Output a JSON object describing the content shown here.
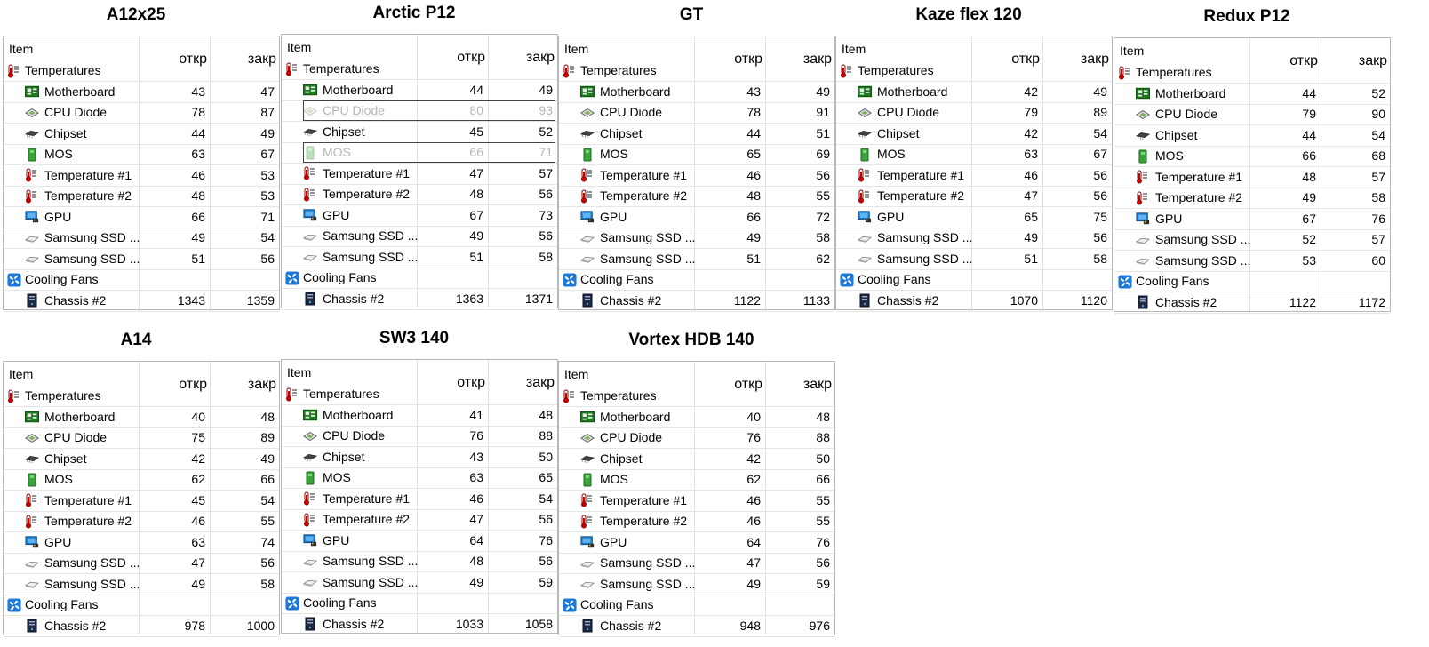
{
  "header": {
    "item": "Item",
    "col1": "откр",
    "col2": "закр"
  },
  "groups": {
    "temps": "Temperatures",
    "fans": "Cooling Fans"
  },
  "colors": {
    "text": "#000000",
    "grid": "#e0e0e0",
    "border": "#b8b8b8",
    "dimmed": "#b6b6b6"
  },
  "panels": [
    {
      "title": "A12x25",
      "rows": [
        {
          "label": "Motherboard",
          "icon": "motherboard-icon",
          "v1": "43",
          "v2": "47"
        },
        {
          "label": "CPU Diode",
          "icon": "cpu-diode-icon",
          "v1": "78",
          "v2": "87"
        },
        {
          "label": "Chipset",
          "icon": "chipset-icon",
          "v1": "44",
          "v2": "49"
        },
        {
          "label": "MOS",
          "icon": "mos-icon",
          "v1": "63",
          "v2": "67"
        },
        {
          "label": "Temperature #1",
          "icon": "thermometer-icon",
          "v1": "46",
          "v2": "53"
        },
        {
          "label": "Temperature #2",
          "icon": "thermometer-icon",
          "v1": "48",
          "v2": "53"
        },
        {
          "label": "GPU",
          "icon": "gpu-icon",
          "v1": "66",
          "v2": "71"
        },
        {
          "label": "Samsung SSD ...",
          "icon": "ssd-icon",
          "v1": "49",
          "v2": "54"
        },
        {
          "label": "Samsung SSD ...",
          "icon": "ssd-icon",
          "v1": "51",
          "v2": "56"
        }
      ],
      "fan": {
        "label": "Chassis #2",
        "icon": "chassis-icon",
        "v1": "1343",
        "v2": "1359"
      }
    },
    {
      "title": "Arctic P12",
      "rows": [
        {
          "label": "Motherboard",
          "icon": "motherboard-icon",
          "v1": "44",
          "v2": "49"
        },
        {
          "label": "CPU Diode",
          "icon": "cpu-diode-icon",
          "v1": "80",
          "v2": "93",
          "dim": true
        },
        {
          "label": "Chipset",
          "icon": "chipset-icon",
          "v1": "45",
          "v2": "52"
        },
        {
          "label": "MOS",
          "icon": "mos-icon",
          "v1": "66",
          "v2": "71",
          "dim": true
        },
        {
          "label": "Temperature #1",
          "icon": "thermometer-icon",
          "v1": "47",
          "v2": "57"
        },
        {
          "label": "Temperature #2",
          "icon": "thermometer-icon",
          "v1": "48",
          "v2": "56"
        },
        {
          "label": "GPU",
          "icon": "gpu-icon",
          "v1": "67",
          "v2": "73"
        },
        {
          "label": "Samsung SSD ...",
          "icon": "ssd-icon",
          "v1": "49",
          "v2": "56"
        },
        {
          "label": "Samsung SSD ...",
          "icon": "ssd-icon",
          "v1": "51",
          "v2": "58"
        }
      ],
      "fan": {
        "label": "Chassis #2",
        "icon": "chassis-icon",
        "v1": "1363",
        "v2": "1371"
      }
    },
    {
      "title": "GT",
      "rows": [
        {
          "label": "Motherboard",
          "icon": "motherboard-icon",
          "v1": "43",
          "v2": "49"
        },
        {
          "label": "CPU Diode",
          "icon": "cpu-diode-icon",
          "v1": "78",
          "v2": "91"
        },
        {
          "label": "Chipset",
          "icon": "chipset-icon",
          "v1": "44",
          "v2": "51"
        },
        {
          "label": "MOS",
          "icon": "mos-icon",
          "v1": "65",
          "v2": "69"
        },
        {
          "label": "Temperature #1",
          "icon": "thermometer-icon",
          "v1": "46",
          "v2": "56"
        },
        {
          "label": "Temperature #2",
          "icon": "thermometer-icon",
          "v1": "48",
          "v2": "55"
        },
        {
          "label": "GPU",
          "icon": "gpu-icon",
          "v1": "66",
          "v2": "72"
        },
        {
          "label": "Samsung SSD ...",
          "icon": "ssd-icon",
          "v1": "49",
          "v2": "58"
        },
        {
          "label": "Samsung SSD ...",
          "icon": "ssd-icon",
          "v1": "51",
          "v2": "62"
        }
      ],
      "fan": {
        "label": "Chassis #2",
        "icon": "chassis-icon",
        "v1": "1122",
        "v2": "1133"
      }
    },
    {
      "title": "Kaze flex 120",
      "rows": [
        {
          "label": "Motherboard",
          "icon": "motherboard-icon",
          "v1": "42",
          "v2": "49"
        },
        {
          "label": "CPU Diode",
          "icon": "cpu-diode-icon",
          "v1": "79",
          "v2": "89"
        },
        {
          "label": "Chipset",
          "icon": "chipset-icon",
          "v1": "42",
          "v2": "54"
        },
        {
          "label": "MOS",
          "icon": "mos-icon",
          "v1": "63",
          "v2": "67"
        },
        {
          "label": "Temperature #1",
          "icon": "thermometer-icon",
          "v1": "46",
          "v2": "56"
        },
        {
          "label": "Temperature #2",
          "icon": "thermometer-icon",
          "v1": "47",
          "v2": "56"
        },
        {
          "label": "GPU",
          "icon": "gpu-icon",
          "v1": "65",
          "v2": "75"
        },
        {
          "label": "Samsung SSD ...",
          "icon": "ssd-icon",
          "v1": "49",
          "v2": "56"
        },
        {
          "label": "Samsung SSD ...",
          "icon": "ssd-icon",
          "v1": "51",
          "v2": "58"
        }
      ],
      "fan": {
        "label": "Chassis #2",
        "icon": "chassis-icon",
        "v1": "1070",
        "v2": "1120"
      }
    },
    {
      "title": "Redux P12",
      "rows": [
        {
          "label": "Motherboard",
          "icon": "motherboard-icon",
          "v1": "44",
          "v2": "52"
        },
        {
          "label": "CPU Diode",
          "icon": "cpu-diode-icon",
          "v1": "79",
          "v2": "90"
        },
        {
          "label": "Chipset",
          "icon": "chipset-icon",
          "v1": "44",
          "v2": "54"
        },
        {
          "label": "MOS",
          "icon": "mos-icon",
          "v1": "66",
          "v2": "68"
        },
        {
          "label": "Temperature #1",
          "icon": "thermometer-icon",
          "v1": "48",
          "v2": "57"
        },
        {
          "label": "Temperature #2",
          "icon": "thermometer-icon",
          "v1": "49",
          "v2": "58"
        },
        {
          "label": "GPU",
          "icon": "gpu-icon",
          "v1": "67",
          "v2": "76"
        },
        {
          "label": "Samsung SSD ...",
          "icon": "ssd-icon",
          "v1": "52",
          "v2": "57"
        },
        {
          "label": "Samsung SSD ...",
          "icon": "ssd-icon",
          "v1": "53",
          "v2": "60"
        }
      ],
      "fan": {
        "label": "Chassis #2",
        "icon": "chassis-icon",
        "v1": "1122",
        "v2": "1172"
      }
    },
    {
      "title": "A14",
      "rows": [
        {
          "label": "Motherboard",
          "icon": "motherboard-icon",
          "v1": "40",
          "v2": "48"
        },
        {
          "label": "CPU Diode",
          "icon": "cpu-diode-icon",
          "v1": "75",
          "v2": "89"
        },
        {
          "label": "Chipset",
          "icon": "chipset-icon",
          "v1": "42",
          "v2": "49"
        },
        {
          "label": "MOS",
          "icon": "mos-icon",
          "v1": "62",
          "v2": "66"
        },
        {
          "label": "Temperature #1",
          "icon": "thermometer-icon",
          "v1": "45",
          "v2": "54"
        },
        {
          "label": "Temperature #2",
          "icon": "thermometer-icon",
          "v1": "46",
          "v2": "55"
        },
        {
          "label": "GPU",
          "icon": "gpu-icon",
          "v1": "63",
          "v2": "74"
        },
        {
          "label": "Samsung SSD ...",
          "icon": "ssd-icon",
          "v1": "47",
          "v2": "56"
        },
        {
          "label": "Samsung SSD ...",
          "icon": "ssd-icon",
          "v1": "49",
          "v2": "58"
        }
      ],
      "fan": {
        "label": "Chassis #2",
        "icon": "chassis-icon",
        "v1": "978",
        "v2": "1000"
      }
    },
    {
      "title": "SW3 140",
      "rows": [
        {
          "label": "Motherboard",
          "icon": "motherboard-icon",
          "v1": "41",
          "v2": "48"
        },
        {
          "label": "CPU Diode",
          "icon": "cpu-diode-icon",
          "v1": "76",
          "v2": "88"
        },
        {
          "label": "Chipset",
          "icon": "chipset-icon",
          "v1": "43",
          "v2": "50"
        },
        {
          "label": "MOS",
          "icon": "mos-icon",
          "v1": "63",
          "v2": "65"
        },
        {
          "label": "Temperature #1",
          "icon": "thermometer-icon",
          "v1": "46",
          "v2": "54"
        },
        {
          "label": "Temperature #2",
          "icon": "thermometer-icon",
          "v1": "47",
          "v2": "56"
        },
        {
          "label": "GPU",
          "icon": "gpu-icon",
          "v1": "64",
          "v2": "76"
        },
        {
          "label": "Samsung SSD ...",
          "icon": "ssd-icon",
          "v1": "48",
          "v2": "56"
        },
        {
          "label": "Samsung SSD ...",
          "icon": "ssd-icon",
          "v1": "49",
          "v2": "59"
        }
      ],
      "fan": {
        "label": "Chassis #2",
        "icon": "chassis-icon",
        "v1": "1033",
        "v2": "1058"
      }
    },
    {
      "title": "Vortex HDB 140",
      "rows": [
        {
          "label": "Motherboard",
          "icon": "motherboard-icon",
          "v1": "40",
          "v2": "48"
        },
        {
          "label": "CPU Diode",
          "icon": "cpu-diode-icon",
          "v1": "76",
          "v2": "88"
        },
        {
          "label": "Chipset",
          "icon": "chipset-icon",
          "v1": "42",
          "v2": "50"
        },
        {
          "label": "MOS",
          "icon": "mos-icon",
          "v1": "62",
          "v2": "66"
        },
        {
          "label": "Temperature #1",
          "icon": "thermometer-icon",
          "v1": "46",
          "v2": "55"
        },
        {
          "label": "Temperature #2",
          "icon": "thermometer-icon",
          "v1": "46",
          "v2": "55"
        },
        {
          "label": "GPU",
          "icon": "gpu-icon",
          "v1": "64",
          "v2": "76"
        },
        {
          "label": "Samsung SSD ...",
          "icon": "ssd-icon",
          "v1": "47",
          "v2": "56"
        },
        {
          "label": "Samsung SSD ...",
          "icon": "ssd-icon",
          "v1": "49",
          "v2": "59"
        }
      ],
      "fan": {
        "label": "Chassis #2",
        "icon": "chassis-icon",
        "v1": "948",
        "v2": "976"
      }
    }
  ]
}
